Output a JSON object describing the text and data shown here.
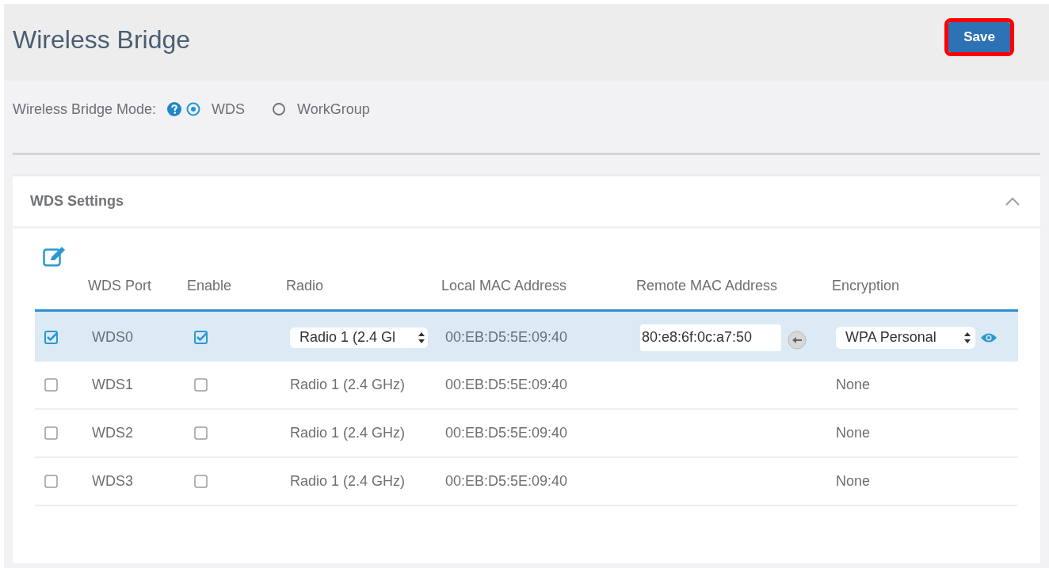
{
  "header": {
    "title": "Wireless Bridge",
    "save_button": "Save"
  },
  "mode": {
    "label": "Wireless Bridge Mode:",
    "options": [
      {
        "label": "WDS",
        "selected": true
      },
      {
        "label": "WorkGroup",
        "selected": false
      }
    ]
  },
  "panel": {
    "title": "WDS Settings",
    "expanded": true
  },
  "table": {
    "columns": [
      "WDS Port",
      "Enable",
      "Radio",
      "Local MAC Address",
      "Remote MAC Address",
      "Encryption"
    ],
    "rows": [
      {
        "kind": "edit",
        "selected": true,
        "port": "WDS0",
        "enabled": true,
        "radio": "Radio 1 (2.4 Gl",
        "local_mac": "00:EB:D5:5E:09:40",
        "remote_mac": "80:e8:6f:0c:a7:50",
        "encryption": "WPA Personal"
      },
      {
        "kind": "view",
        "selected": false,
        "port": "WDS1",
        "enabled": false,
        "radio": "Radio 1 (2.4 GHz)",
        "local_mac": "00:EB:D5:5E:09:40",
        "encryption": "None"
      },
      {
        "kind": "view",
        "selected": false,
        "port": "WDS2",
        "enabled": false,
        "radio": "Radio 1 (2.4 GHz)",
        "local_mac": "00:EB:D5:5E:09:40",
        "encryption": "None"
      },
      {
        "kind": "view",
        "selected": false,
        "port": "WDS3",
        "enabled": false,
        "radio": "Radio 1 (2.4 GHz)",
        "local_mac": "00:EB:D5:5E:09:40",
        "encryption": "None"
      }
    ]
  }
}
